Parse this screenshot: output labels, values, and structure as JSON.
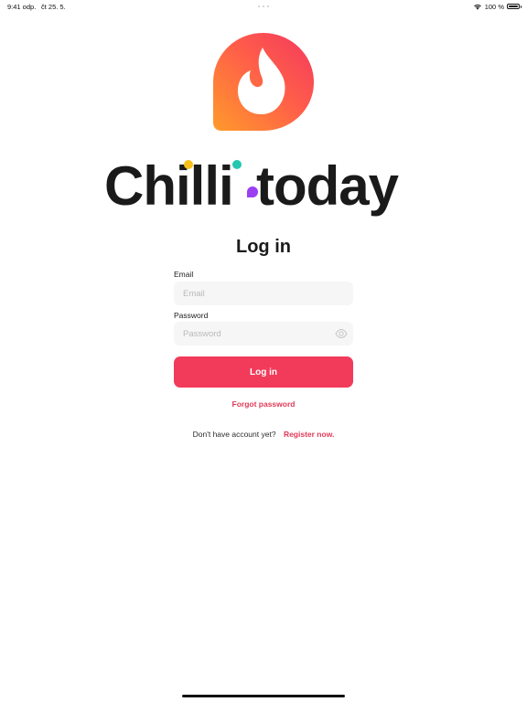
{
  "status_bar": {
    "time": "9:41 odp.",
    "date": "čt 25. 5.",
    "battery_percent": "100 %",
    "battery_level": 1.0,
    "icons": [
      "wifi-icon",
      "battery-icon"
    ]
  },
  "brand": {
    "name": "Chilli.today",
    "colors": {
      "gradient_start": "#ff8a2a",
      "gradient_end": "#f3385e",
      "dot_yellow": "#f7c01b",
      "dot_teal": "#25c7b0",
      "dot_purple": "#9b3ff2",
      "text": "#1a1a1a"
    }
  },
  "login": {
    "title": "Log in",
    "email_label": "Email",
    "email_placeholder": "Email",
    "password_label": "Password",
    "password_placeholder": "Password",
    "submit_label": "Log in",
    "forgot_password": "Forgot password",
    "no_account_text": "Don't have account yet?",
    "register_link": "Register now."
  },
  "colors": {
    "accent": "#f23a5a",
    "field_bg": "#f6f6f6"
  }
}
